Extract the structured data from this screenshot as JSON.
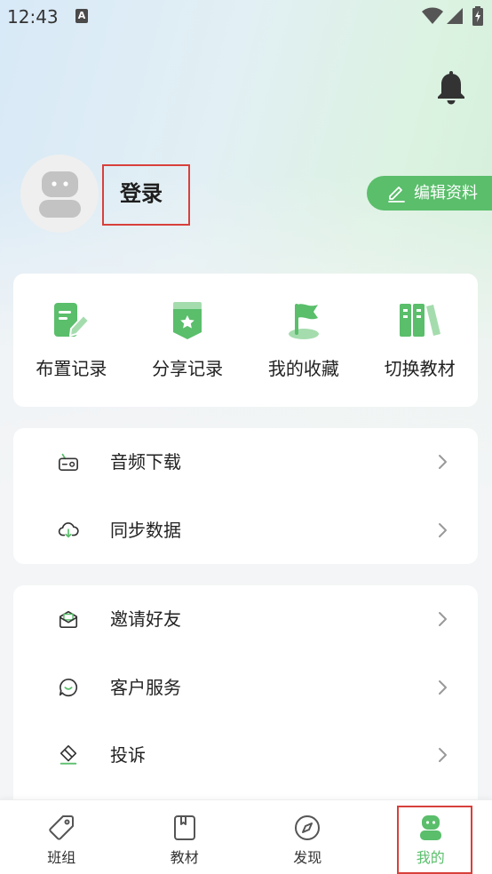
{
  "status_bar": {
    "time": "12:43",
    "notification_badge": "A",
    "icons": [
      "wifi-icon",
      "signal-icon",
      "battery-charging-icon"
    ]
  },
  "header": {
    "notification_icon": "bell-icon",
    "avatar_icon": "robot-avatar-icon",
    "login_label": "登录",
    "edit_profile_label": "编辑资料",
    "edit_profile_icon": "pencil-icon"
  },
  "quick_actions": [
    {
      "label": "布置记录",
      "icon": "assignment-record-icon"
    },
    {
      "label": "分享记录",
      "icon": "share-record-icon"
    },
    {
      "label": "我的收藏",
      "icon": "favorite-flag-icon"
    },
    {
      "label": "切换教材",
      "icon": "switch-textbook-icon"
    }
  ],
  "menu_group_1": [
    {
      "label": "音频下载",
      "icon": "audio-download-icon"
    },
    {
      "label": "同步数据",
      "icon": "cloud-sync-icon"
    }
  ],
  "menu_group_2": [
    {
      "label": "邀请好友",
      "icon": "invite-envelope-icon"
    },
    {
      "label": "客户服务",
      "icon": "customer-service-icon"
    },
    {
      "label": "投诉",
      "icon": "complaint-icon"
    }
  ],
  "bottom_nav": [
    {
      "label": "班组",
      "icon": "tag-icon",
      "active": false
    },
    {
      "label": "教材",
      "icon": "book-icon",
      "active": false
    },
    {
      "label": "发现",
      "icon": "compass-icon",
      "active": false
    },
    {
      "label": "我的",
      "icon": "robot-profile-icon",
      "active": true
    }
  ],
  "colors": {
    "accent": "#5abe6b",
    "accent_light": "#a5dcae",
    "annotation_red": "#d8403b"
  }
}
